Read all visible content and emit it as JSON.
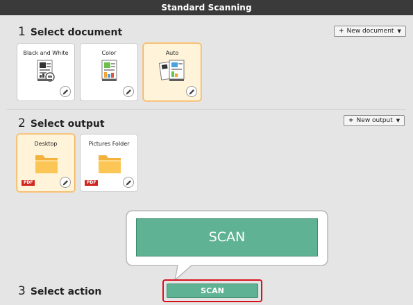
{
  "window": {
    "title": "Standard Scanning"
  },
  "colors": {
    "accent_green": "#5fb394",
    "highlight_red": "#d7121d",
    "selected_tile": "#fff4da",
    "selected_border": "#f3b45c"
  },
  "documents": {
    "number": "1",
    "title": "Select document",
    "new_button": "New document",
    "new_icon": "plus-icon",
    "tiles": [
      {
        "label": "Black and White",
        "selected": false,
        "icon": "bw-document-icon"
      },
      {
        "label": "Color",
        "selected": false,
        "icon": "color-document-icon"
      },
      {
        "label": "Auto",
        "selected": true,
        "icon": "auto-document-icon"
      }
    ]
  },
  "outputs": {
    "number": "2",
    "title": "Select output",
    "new_button": "New output",
    "tiles": [
      {
        "label": "Desktop",
        "selected": true,
        "badge": "PDF",
        "icon": "folder-icon"
      },
      {
        "label": "Pictures Folder",
        "selected": false,
        "badge": "PDF",
        "icon": "folder-icon"
      }
    ]
  },
  "action": {
    "number": "3",
    "title": "Select action",
    "scan_label": "SCAN",
    "callout_label": "SCAN"
  }
}
